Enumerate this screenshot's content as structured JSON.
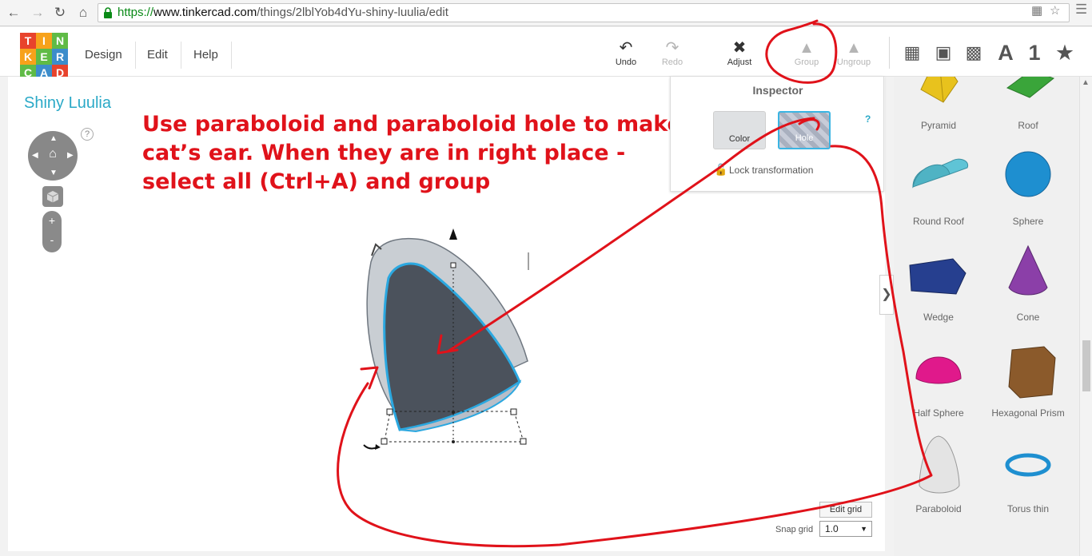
{
  "browser": {
    "url_protocol": "https://",
    "url_host": "www.tinkercad.com",
    "url_path": "/things/2lblYob4dYu-shiny-luulia/edit",
    "back_icon": "back-arrow",
    "forward_icon": "forward-arrow",
    "reload_icon": "reload",
    "home_icon": "home"
  },
  "logo": {
    "letters": [
      "T",
      "I",
      "N",
      "K",
      "E",
      "R",
      "C",
      "A",
      "D"
    ],
    "colors": [
      "#e8432c",
      "#f7a21b",
      "#5fbb46",
      "#f7a21b",
      "#5fbb46",
      "#3c8dcb",
      "#5fbb46",
      "#3c8dcb",
      "#e8432c"
    ]
  },
  "menu": {
    "design": "Design",
    "edit": "Edit",
    "help": "Help"
  },
  "toolbar": {
    "undo": "Undo",
    "redo": "Redo",
    "adjust": "Adjust",
    "group": "Group",
    "ungroup": "Ungroup",
    "view_text": "A",
    "view_number": "1"
  },
  "design": {
    "title": "Shiny Luulia",
    "help": "?"
  },
  "navigation": {
    "zoom_in": "+",
    "zoom_out": "-"
  },
  "annotation": {
    "line1": "Use paraboloid and paraboloid hole to make",
    "line2": "cat’s ear. When they are in right place -",
    "line3": "select all (Ctrl+A) and group",
    "color": "#e0121a"
  },
  "inspector": {
    "title": "Inspector",
    "color_label": "Color",
    "hole_label": "Hole",
    "help": "?",
    "lock_label": "Lock transformation"
  },
  "shapes": [
    {
      "name": "Pyramid",
      "color": "#e8c21d"
    },
    {
      "name": "Roof",
      "color": "#3aa53a"
    },
    {
      "name": "Round Roof",
      "color": "#5fc4d6"
    },
    {
      "name": "Sphere",
      "color": "#1e8fd0"
    },
    {
      "name": "Wedge",
      "color": "#263f8f"
    },
    {
      "name": "Cone",
      "color": "#8b3fa8"
    },
    {
      "name": "Half Sphere",
      "color": "#e0198b"
    },
    {
      "name": "Hexagonal Prism",
      "color": "#8b5a2b"
    },
    {
      "name": "Paraboloid",
      "color": "#e4e4e4"
    },
    {
      "name": "Torus thin",
      "color": "#1e8fd0"
    }
  ],
  "grid": {
    "edit_grid": "Edit grid",
    "snap_label": "Snap grid",
    "snap_value": "1.0"
  }
}
